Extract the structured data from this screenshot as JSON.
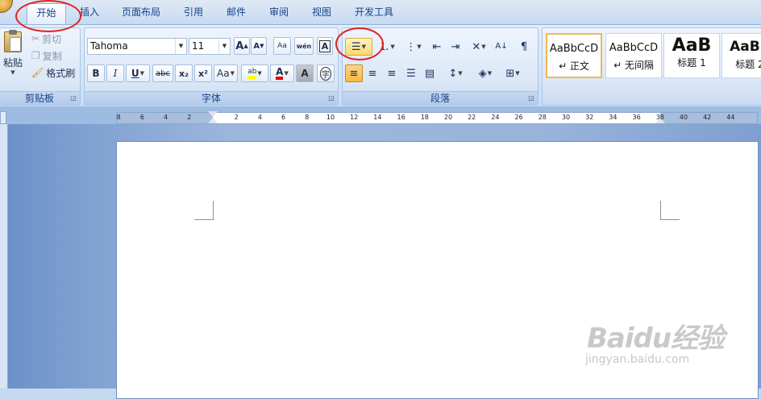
{
  "tabs": [
    {
      "label": "开始",
      "active": true
    },
    {
      "label": "插入"
    },
    {
      "label": "页面布局"
    },
    {
      "label": "引用"
    },
    {
      "label": "邮件"
    },
    {
      "label": "审阅"
    },
    {
      "label": "视图"
    },
    {
      "label": "开发工具"
    }
  ],
  "clipboard": {
    "group_label": "剪贴板",
    "paste_label": "粘贴",
    "cut_label": "剪切",
    "copy_label": "复制",
    "format_painter_label": "格式刷"
  },
  "font": {
    "group_label": "字体",
    "font_name": "Tahoma",
    "font_size": "11",
    "grow_label": "A",
    "shrink_label": "A",
    "clear_label": "Aa",
    "phonetic_label": "wén",
    "bold_label": "B",
    "italic_label": "I",
    "underline_label": "U",
    "strike_label": "abc",
    "subscript_label": "x₂",
    "superscript_label": "x²",
    "case_label": "Aa",
    "highlight_label": "ab",
    "font_color_label": "A",
    "shading_label": "A",
    "enclose_label": "字",
    "border_char_label": "A"
  },
  "paragraph": {
    "group_label": "段落"
  },
  "styles": {
    "items": [
      {
        "sample": "AaBbCcD",
        "name": "↵ 正文",
        "selected": true
      },
      {
        "sample": "AaBbCcD",
        "name": "↵ 无间隔"
      },
      {
        "sample": "AaB",
        "name": "标题 1"
      },
      {
        "sample": "AaBb",
        "name": "标题 2"
      }
    ]
  },
  "ruler": {
    "left_numbers": [
      "8",
      "6",
      "4",
      "2"
    ],
    "right_numbers": [
      "2",
      "4",
      "6",
      "8",
      "10",
      "12",
      "14",
      "16",
      "18",
      "20",
      "22",
      "24",
      "26",
      "28",
      "30",
      "32",
      "34",
      "36",
      "38",
      "40",
      "42",
      "44"
    ]
  },
  "watermark": {
    "text": "Baidu经验",
    "sub": "jingyan.baidu.com"
  },
  "colors": {
    "highlight": "#ffff00",
    "font_color": "#e00000",
    "annotation": "#e02020"
  }
}
